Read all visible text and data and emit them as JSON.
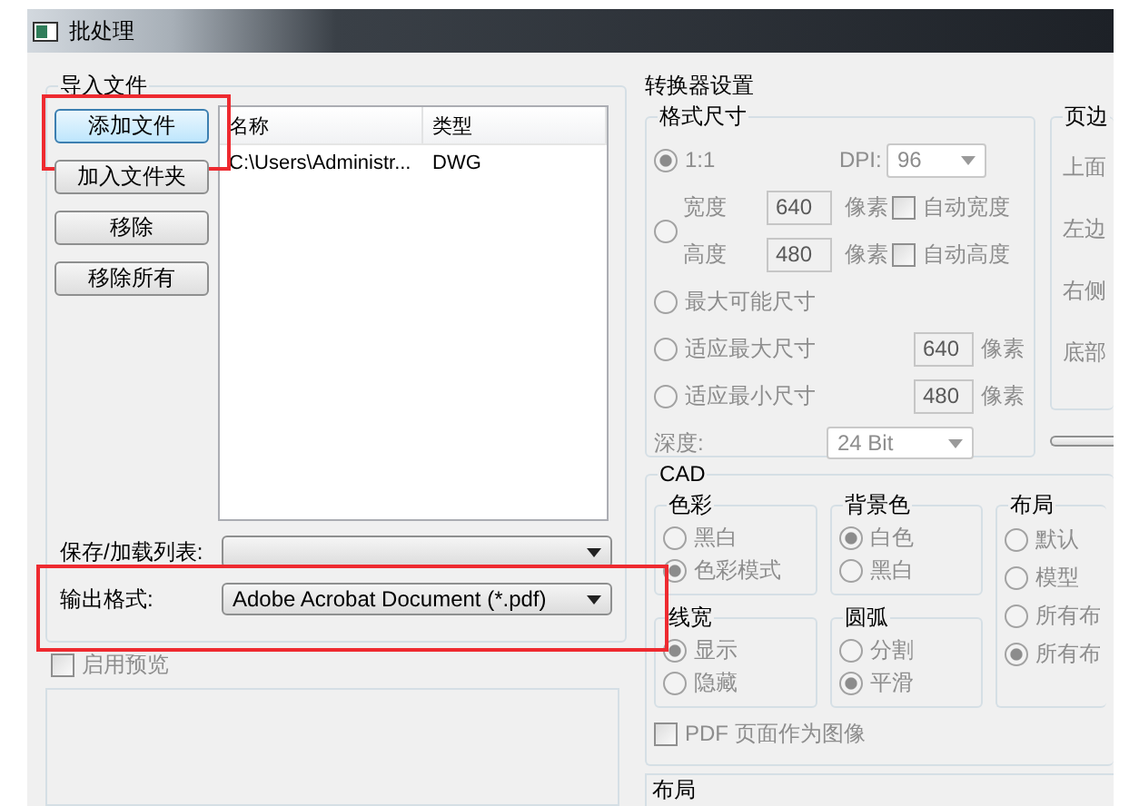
{
  "window": {
    "title": "批处理"
  },
  "import_group": {
    "title": "导入文件",
    "buttons": [
      {
        "label": "添加文件",
        "focused": true,
        "highlighted": true
      },
      {
        "label": "加入文件夹",
        "focused": false,
        "highlighted": false
      },
      {
        "label": "移除",
        "focused": false,
        "highlighted": false
      },
      {
        "label": "移除所有",
        "focused": false,
        "highlighted": false
      }
    ],
    "file_list": {
      "columns": [
        "名称",
        "类型"
      ],
      "rows": [
        {
          "name": "C:\\Users\\Administr...",
          "type": "DWG"
        }
      ]
    },
    "save_load_list": {
      "label": "保存/加载列表:"
    },
    "output_format": {
      "label": "输出格式:",
      "value": "Adobe Acrobat Document (*.pdf)",
      "highlighted": true
    }
  },
  "preview": {
    "label": "启用预览",
    "checked": false
  },
  "converter": {
    "title": "转换器设置",
    "format_size": {
      "title": "格式尺寸",
      "disabled": true,
      "scale_option": {
        "label": "1:1",
        "selected": true
      },
      "dpi": {
        "label": "DPI:",
        "value": "96"
      },
      "custom_option": {
        "selected": false,
        "width": {
          "label": "宽度",
          "value": "640",
          "unit": "像素",
          "auto_label": "自动宽度",
          "auto_checked": false
        },
        "height": {
          "label": "高度",
          "value": "480",
          "unit": "像素",
          "auto_label": "自动高度",
          "auto_checked": false
        }
      },
      "max_possible_option": {
        "label": "最大可能尺寸",
        "selected": false
      },
      "fit_max_option": {
        "label": "适应最大尺寸",
        "selected": false,
        "value": "640",
        "unit": "像素"
      },
      "fit_min_option": {
        "label": "适应最小尺寸",
        "selected": false,
        "value": "480",
        "unit": "像素"
      },
      "depth": {
        "label": "深度:",
        "value": "24 Bit"
      }
    },
    "margins": {
      "title": "页边",
      "labels": [
        "上面",
        "左边",
        "右侧",
        "底部"
      ]
    },
    "cad": {
      "title": "CAD",
      "disabled": true,
      "groups": [
        {
          "title": "色彩",
          "options": [
            {
              "label": "黑白",
              "selected": false
            },
            {
              "label": "色彩模式",
              "selected": true
            }
          ]
        },
        {
          "title": "背景色",
          "options": [
            {
              "label": "白色",
              "selected": true
            },
            {
              "label": "黑白",
              "selected": false
            }
          ]
        },
        {
          "title": "布局",
          "options": [
            {
              "label": "默认",
              "selected": false
            },
            {
              "label": "模型",
              "selected": false
            },
            {
              "label": "所有布",
              "selected": false
            },
            {
              "label": "所有布",
              "selected": true
            }
          ]
        },
        {
          "title": "线宽",
          "options": [
            {
              "label": "显示",
              "selected": true
            },
            {
              "label": "隐藏",
              "selected": false
            }
          ]
        },
        {
          "title": "圆弧",
          "options": [
            {
              "label": "分割",
              "selected": false
            },
            {
              "label": "平滑",
              "selected": true
            }
          ]
        }
      ],
      "pdf_as_image": {
        "label": "PDF 页面作为图像",
        "checked": false
      }
    },
    "layout_title": "布局"
  }
}
